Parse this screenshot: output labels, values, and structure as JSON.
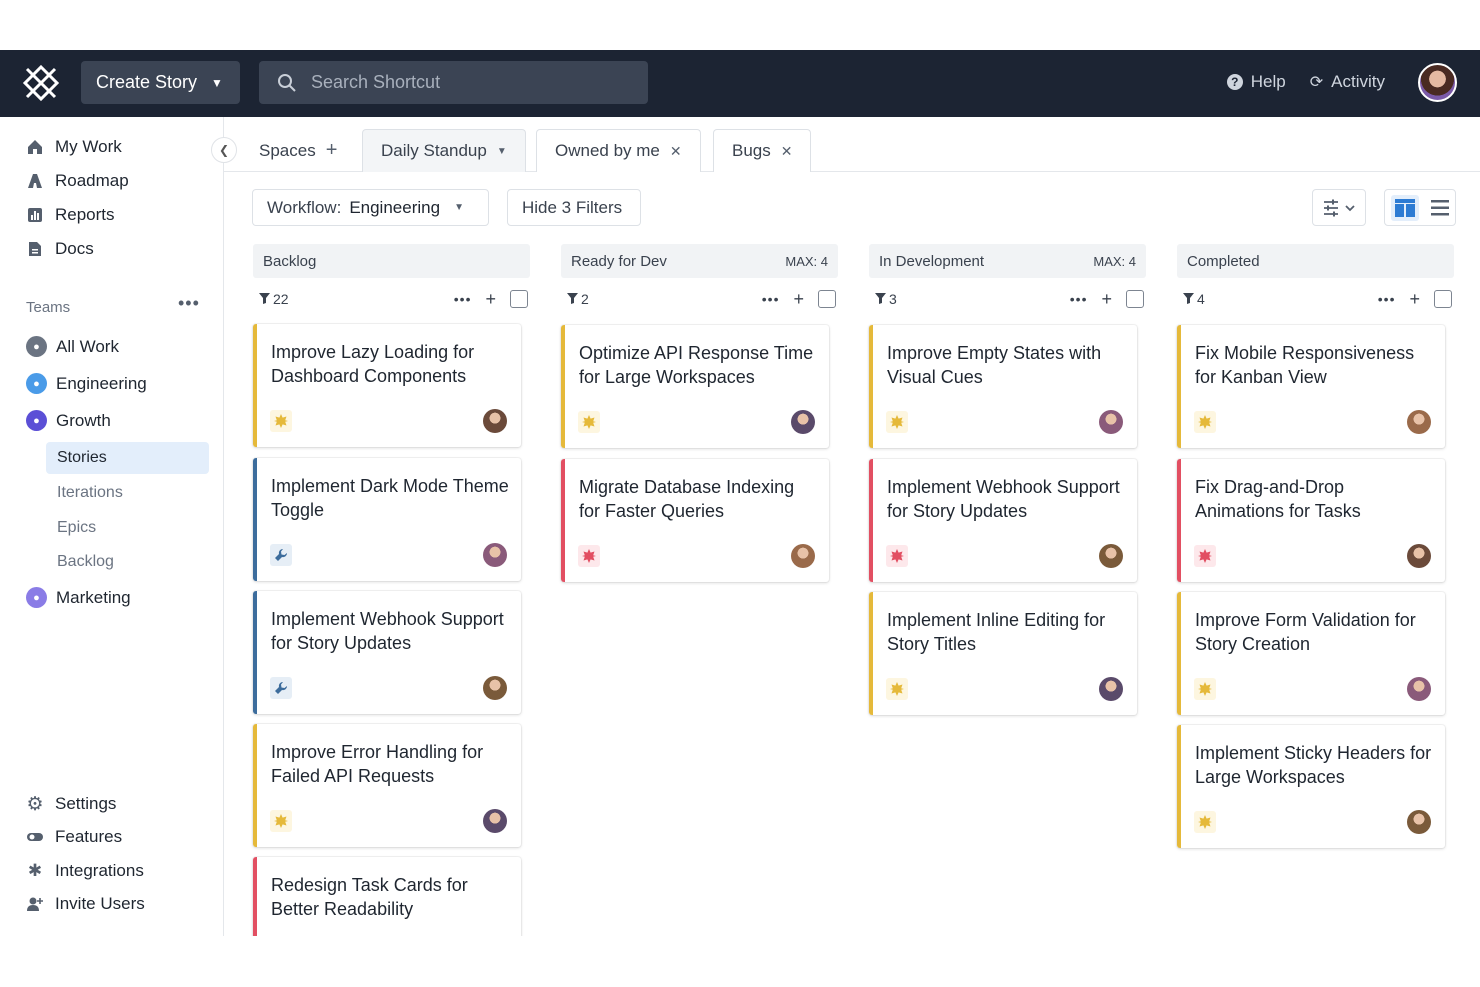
{
  "header": {
    "create_label": "Create Story",
    "search_placeholder": "Search Shortcut",
    "help_label": "Help",
    "activity_label": "Activity"
  },
  "sidebar": {
    "nav": [
      {
        "label": "My Work",
        "icon": "home-icon"
      },
      {
        "label": "Roadmap",
        "icon": "roadmap-icon"
      },
      {
        "label": "Reports",
        "icon": "chart-icon"
      },
      {
        "label": "Docs",
        "icon": "doc-icon"
      }
    ],
    "teams_label": "Teams",
    "teams": [
      {
        "label": "All Work",
        "color": "#6b7482"
      },
      {
        "label": "Engineering",
        "color": "#4a9be8"
      },
      {
        "label": "Growth",
        "color": "#5b4fd6"
      },
      {
        "label": "Marketing",
        "color": "#8a7ce6"
      }
    ],
    "growth_sub": [
      "Stories",
      "Iterations",
      "Epics",
      "Backlog"
    ],
    "bottom": [
      {
        "label": "Settings",
        "icon": "gear-icon"
      },
      {
        "label": "Features",
        "icon": "toggle-icon"
      },
      {
        "label": "Integrations",
        "icon": "puzzle-icon"
      },
      {
        "label": "Invite Users",
        "icon": "add-user-icon"
      }
    ]
  },
  "tabs": {
    "spaces": "Spaces",
    "items": [
      "Daily Standup",
      "Owned by me",
      "Bugs"
    ]
  },
  "filters": {
    "workflow_prefix": "Workflow:",
    "workflow_value": "Engineering",
    "hide_filters": "Hide 3 Filters"
  },
  "columns": [
    {
      "name": "Backlog",
      "max": "",
      "count": "22",
      "cards": [
        {
          "title": "Improve Lazy Loading for Dashboard Components",
          "kind": "feature"
        },
        {
          "title": "Implement Dark Mode Theme Toggle",
          "kind": "chore"
        },
        {
          "title": "Implement Webhook Support for Story Updates",
          "kind": "chore"
        },
        {
          "title": "Improve Error Handling for Failed API Requests",
          "kind": "feature"
        },
        {
          "title": "Redesign Task Cards for Better Readability",
          "kind": "bug"
        }
      ]
    },
    {
      "name": "Ready for Dev",
      "max": "MAX: 4",
      "count": "2",
      "cards": [
        {
          "title": "Optimize API Response Time for Large Workspaces",
          "kind": "feature"
        },
        {
          "title": "Migrate Database Indexing for Faster Queries",
          "kind": "bug"
        }
      ]
    },
    {
      "name": "In Development",
      "max": "MAX: 4",
      "count": "3",
      "cards": [
        {
          "title": "Improve Empty States with Visual Cues",
          "kind": "feature"
        },
        {
          "title": "Implement Webhook Support for Story Updates",
          "kind": "bug"
        },
        {
          "title": "Implement Inline Editing for Story Titles",
          "kind": "feature"
        }
      ]
    },
    {
      "name": "Completed",
      "max": "",
      "count": "4",
      "cards": [
        {
          "title": "Fix Mobile Responsiveness for Kanban View",
          "kind": "feature"
        },
        {
          "title": "Fix Drag-and-Drop Animations for Tasks",
          "kind": "bug"
        },
        {
          "title": "Improve Form Validation for Story Creation",
          "kind": "feature"
        },
        {
          "title": "Implement Sticky Headers for Large Workspaces",
          "kind": "feature"
        }
      ]
    }
  ]
}
